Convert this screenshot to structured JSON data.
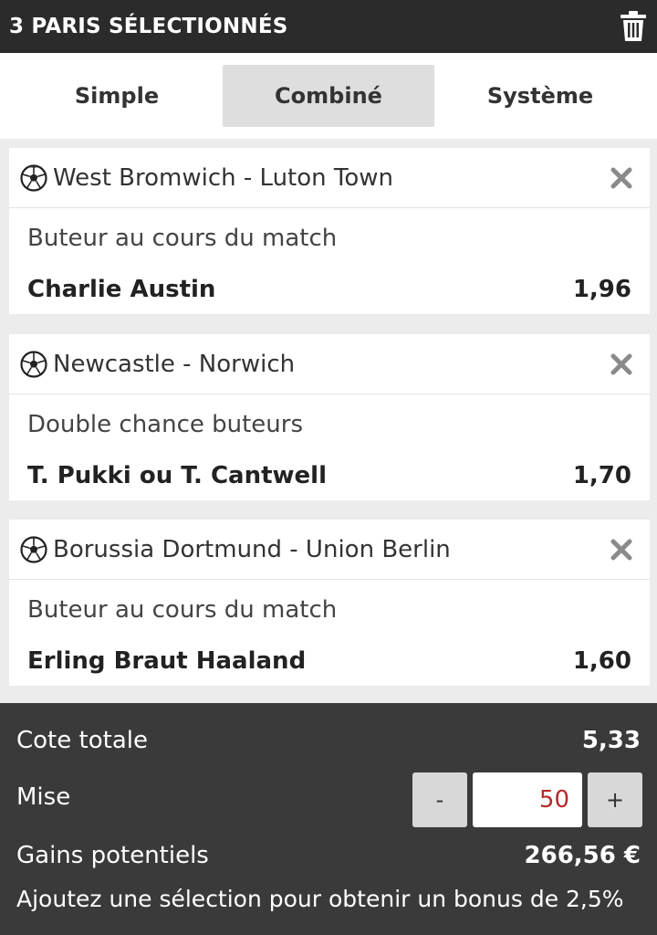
{
  "header": {
    "title": "3 PARIS SÉLECTIONNÉS"
  },
  "tabs": [
    {
      "label": "Simple",
      "active": false
    },
    {
      "label": "Combiné",
      "active": true
    },
    {
      "label": "Système",
      "active": false
    }
  ],
  "bets": [
    {
      "match": "West Bromwich - Luton Town",
      "market": "Buteur au cours du match",
      "selection": "Charlie Austin",
      "odd": "1,96"
    },
    {
      "match": "Newcastle - Norwich",
      "market": "Double chance buteurs",
      "selection": "T. Pukki ou T. Cantwell",
      "odd": "1,70"
    },
    {
      "match": "Borussia Dortmund - Union Berlin",
      "market": "Buteur au cours du match",
      "selection": "Erling Braut Haaland",
      "odd": "1,60"
    }
  ],
  "summary": {
    "total_odds_label": "Cote totale",
    "total_odds_value": "5,33",
    "stake_label": "Mise",
    "stake_value": "50",
    "minus_label": "-",
    "plus_label": "+",
    "winnings_label": "Gains potentiels",
    "winnings_value": "266,56 €",
    "bonus_text": "Ajoutez une sélection pour obtenir un bonus de 2,5%"
  },
  "colors": {
    "header_bg": "#2b2b2b",
    "summary_bg": "#3a3a3a",
    "active_tab_bg": "#dedede",
    "stake_text": "#b52a2a"
  },
  "icons": {
    "trash": "trash-icon",
    "ball": "soccer-ball-icon",
    "remove": "close-icon"
  }
}
